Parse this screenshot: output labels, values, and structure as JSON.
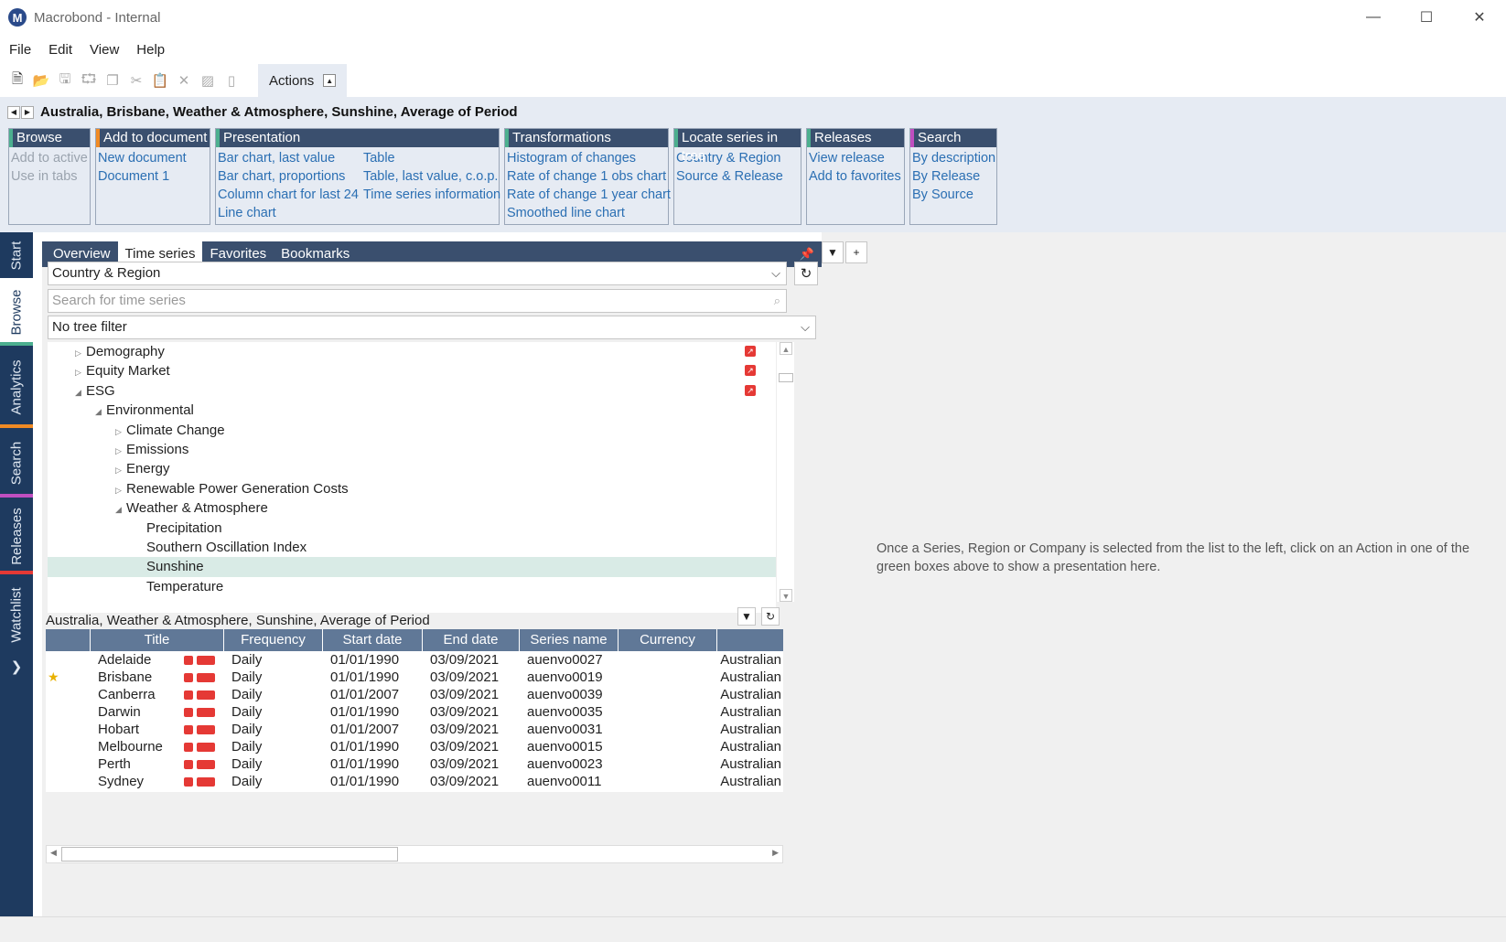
{
  "window": {
    "title": "Macrobond - Internal",
    "logo_letter": "M"
  },
  "menu": [
    "File",
    "Edit",
    "View",
    "Help"
  ],
  "toolbar": {
    "actions_label": "Actions"
  },
  "breadcrumb": "Australia, Brisbane, Weather & Atmosphere, Sunshine, Average of Period",
  "ribbon": {
    "browse": {
      "title": "Browse",
      "items": [
        "Add to active",
        "Use in tabs"
      ]
    },
    "add_to_document": {
      "title": "Add to document",
      "items": [
        "New document",
        "Document 1"
      ]
    },
    "presentation": {
      "title": "Presentation",
      "col1": [
        "Bar chart, last value",
        "Bar chart, proportions",
        "Column chart for last 24",
        "Line chart"
      ],
      "col2": [
        "Table",
        "Table, last value, c.o.p.",
        "Time series information"
      ]
    },
    "transformations": {
      "title": "Transformations",
      "items": [
        "Histogram of changes",
        "Rate of change 1 obs chart",
        "Rate of change 1 year chart",
        "Smoothed line chart"
      ]
    },
    "locate": {
      "title": "Locate series in tree",
      "items": [
        "Country & Region",
        "Source & Release"
      ]
    },
    "releases": {
      "title": "Releases",
      "items": [
        "View release",
        "Add to favorites"
      ]
    },
    "search": {
      "title": "Search",
      "items": [
        "By description",
        "By Release",
        "By Source"
      ]
    }
  },
  "sidetabs": [
    "Start",
    "Browse",
    "Analytics",
    "Search",
    "Releases",
    "Watchlist"
  ],
  "panel": {
    "tabs": [
      "Overview",
      "Time series",
      "Favorites",
      "Bookmarks"
    ],
    "tree_source": "Country & Region",
    "search_placeholder": "Search for time series",
    "tree_filter": "No tree filter",
    "tree": [
      "Demography",
      "Equity Market",
      "ESG",
      "Environmental",
      "Climate Change",
      "Emissions",
      "Energy",
      "Renewable Power Generation Costs",
      "Weather & Atmosphere",
      "Precipitation",
      "Southern Oscillation Index",
      "Sunshine",
      "Temperature"
    ],
    "list_title": "Australia, Weather & Atmosphere, Sunshine, Average of Period",
    "columns": [
      "Title",
      "Frequency",
      "Start date",
      "End date",
      "Series name",
      "Currency"
    ],
    "rows": [
      [
        "Adelaide",
        "Daily",
        "01/01/1990",
        "03/09/2021",
        "auenvo0027",
        "Australian"
      ],
      [
        "Brisbane",
        "Daily",
        "01/01/1990",
        "03/09/2021",
        "auenvo0019",
        "Australian"
      ],
      [
        "Canberra",
        "Daily",
        "01/01/2007",
        "03/09/2021",
        "auenvo0039",
        "Australian"
      ],
      [
        "Darwin",
        "Daily",
        "01/01/1990",
        "03/09/2021",
        "auenvo0035",
        "Australian"
      ],
      [
        "Hobart",
        "Daily",
        "01/01/2007",
        "03/09/2021",
        "auenvo0031",
        "Australian"
      ],
      [
        "Melbourne",
        "Daily",
        "01/01/1990",
        "03/09/2021",
        "auenvo0015",
        "Australian"
      ],
      [
        "Perth",
        "Daily",
        "01/01/1990",
        "03/09/2021",
        "auenvo0023",
        "Australian"
      ],
      [
        "Sydney",
        "Daily",
        "01/01/1990",
        "03/09/2021",
        "auenvo0011",
        "Australian"
      ]
    ]
  },
  "hint": "Once a Series, Region or Company is selected from the list to the left, click on an Action in one of the green boxes above to show a presentation here."
}
